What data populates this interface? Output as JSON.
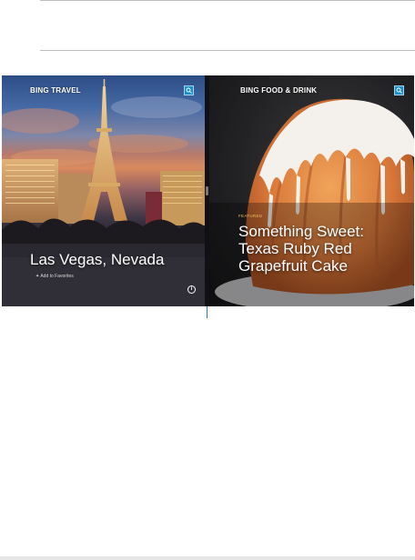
{
  "travel_app": {
    "header": "BING TRAVEL",
    "place_title": "Las Vegas, Nevada",
    "favorites_label": "Add to Favorites",
    "info_icon": "info-circle-icon",
    "search_icon": "search-icon"
  },
  "food_app": {
    "header": "BING FOOD & DRINK",
    "featured_label": "FEATURED",
    "recipe_title": "Something Sweet: Texas Ruby Red Grapefruit Cake",
    "search_icon": "search-icon"
  },
  "colors": {
    "search_button": "#1c8fc9",
    "divider_accent": "#2b7fc4"
  }
}
